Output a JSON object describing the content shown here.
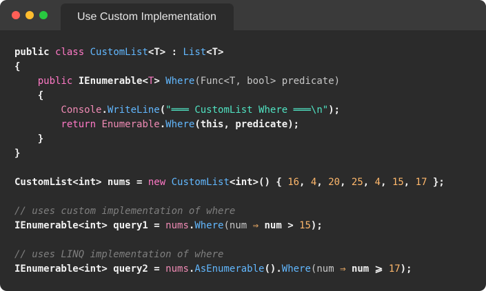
{
  "window": {
    "tab_title": "Use Custom Implementation",
    "colors": {
      "close": "#fe5f57",
      "minimize": "#febc2e",
      "maximize": "#28c840",
      "background": "#2b2b2b"
    }
  },
  "code": {
    "l1": {
      "a": "public",
      "b": "class",
      "c": "CustomList",
      "d": "<T> : ",
      "e": "List",
      "f": "<T>"
    },
    "l2": "{",
    "l3": {
      "a": "    public",
      "b": " IEnumerable<",
      "c": "T",
      "d": "> ",
      "e": "Where",
      "f": "(Func<T, bool> predicate)"
    },
    "l4": "    {",
    "l5": {
      "a": "        Console",
      "b": ".",
      "c": "WriteLine",
      "d": "(",
      "e": "\"═══ CustomList Where ═══\\n\"",
      "f": ");"
    },
    "l6": {
      "a": "        return",
      "b": " Enumerable",
      "c": ".",
      "d": "Where",
      "e": "(this, predicate);"
    },
    "l7": "    }",
    "l8": "}",
    "l9": "",
    "l10": {
      "a": "CustomList<int> nums = ",
      "b": "new",
      "c": " CustomList",
      "d": "<int>() { ",
      "n1": "16",
      "n2": "4",
      "n3": "20",
      "n4": "25",
      "n5": "4",
      "n6": "15",
      "n7": "17",
      "sep": ", ",
      "end": " };"
    },
    "l11": "",
    "l12": "// uses custom implementation of where",
    "l13": {
      "a": "IEnumerable<int> query1 = ",
      "b": "nums",
      "c": ".",
      "d": "Where",
      "e": "(num",
      "f": " ⇒ ",
      "g": "num > ",
      "h": "15",
      "i": ");"
    },
    "l14": "",
    "l15": "// uses LINQ implementation of where",
    "l16": {
      "a": "IEnumerable<int> query2 = ",
      "b": "nums",
      "c": ".",
      "d": "AsEnumerable",
      "e": "().",
      "f": "Where",
      "g": "(num",
      "h": " ⇒ ",
      "i": "num ⩾ ",
      "j": "17",
      "k": ");"
    }
  }
}
